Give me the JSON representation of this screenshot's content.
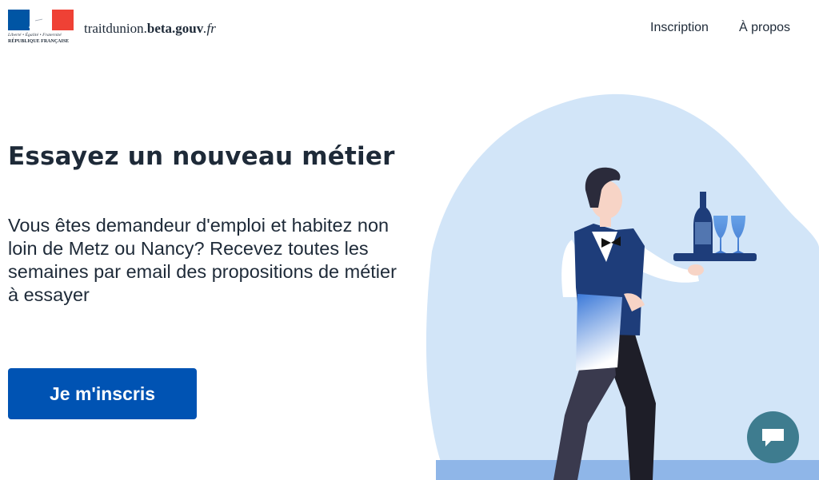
{
  "header": {
    "motto": "Liberté • Égalité • Fraternité",
    "republique": "RÉPUBLIQUE FRANÇAISE",
    "brand": {
      "name": "traitdunion.",
      "domain": "beta.gouv",
      "tld": ".fr"
    },
    "nav": [
      {
        "label": "Inscription"
      },
      {
        "label": "À propos"
      }
    ]
  },
  "hero": {
    "title": "Essayez un nouveau métier",
    "lead": "Vous êtes demandeur d'emploi et habitez non loin de Metz ou Nancy? Recevez toutes les semaines par email des propositions de métier à essayer",
    "cta_label": "Je m'inscris"
  },
  "illustration": {
    "subject": "waiter-carrying-tray-illustration"
  },
  "chat": {
    "icon": "chat-bubble-icon"
  },
  "colors": {
    "primary": "#0053b3",
    "text": "#1e2a38",
    "blob": "#d2e5f8",
    "chat": "#3e7c8f",
    "flag_blue": "#0055a4",
    "flag_red": "#ef4135"
  }
}
